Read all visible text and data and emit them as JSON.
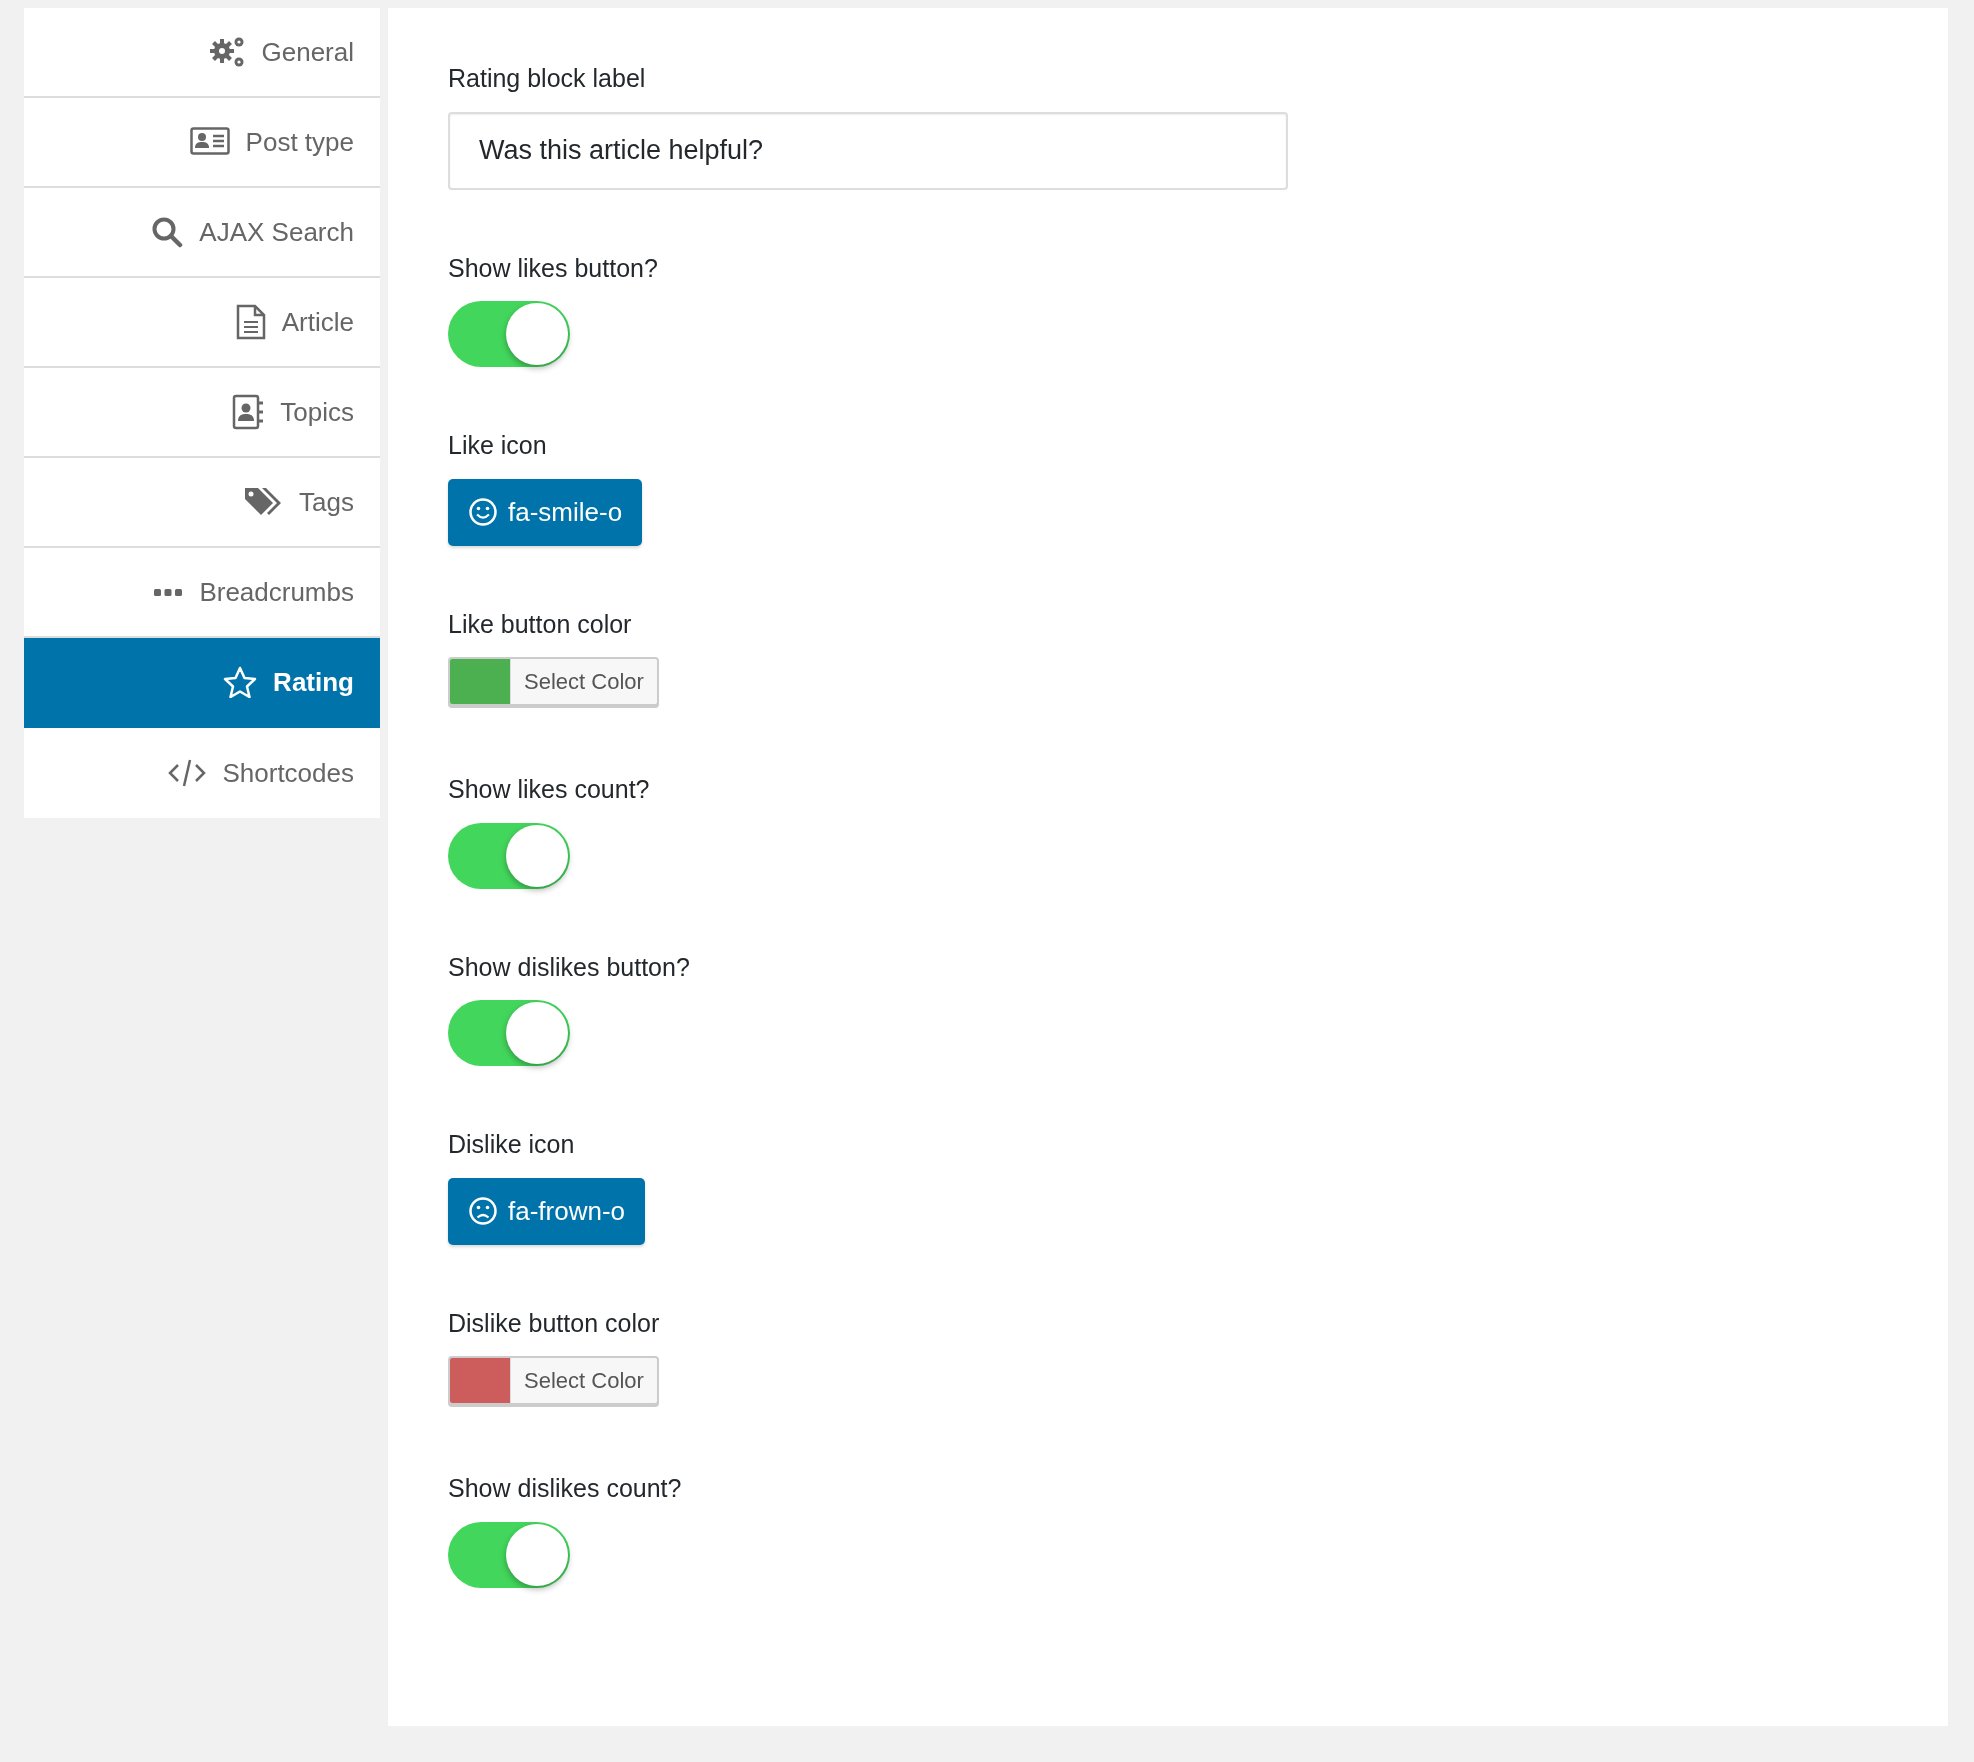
{
  "sidebar": {
    "items": [
      {
        "label": "General",
        "selected": false
      },
      {
        "label": "Post type",
        "selected": false
      },
      {
        "label": "AJAX Search",
        "selected": false
      },
      {
        "label": "Article",
        "selected": false
      },
      {
        "label": "Topics",
        "selected": false
      },
      {
        "label": "Tags",
        "selected": false
      },
      {
        "label": "Breadcrumbs",
        "selected": false
      },
      {
        "label": "Rating",
        "selected": true
      },
      {
        "label": "Shortcodes",
        "selected": false
      }
    ]
  },
  "settings": [
    {
      "kind": "text",
      "label": "Rating block label",
      "value": "Was this article helpful?"
    },
    {
      "kind": "toggle",
      "label": "Show likes button?",
      "on": true
    },
    {
      "kind": "icon",
      "label": "Like icon",
      "button": "fa-smile-o"
    },
    {
      "kind": "color",
      "label": "Like button color",
      "color": "#4caf50",
      "button": "Select Color"
    },
    {
      "kind": "toggle",
      "label": "Show likes count?",
      "on": true
    },
    {
      "kind": "toggle",
      "label": "Show dislikes button?",
      "on": true
    },
    {
      "kind": "icon",
      "label": "Dislike icon",
      "button": "fa-frown-o"
    },
    {
      "kind": "color",
      "label": "Dislike button color",
      "color": "#cd5c5c",
      "button": "Select Color"
    },
    {
      "kind": "toggle",
      "label": "Show dislikes count?",
      "on": true
    }
  ]
}
